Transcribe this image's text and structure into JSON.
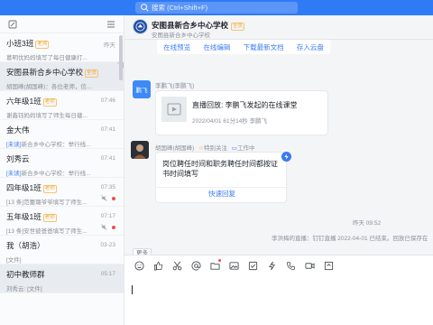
{
  "search": {
    "placeholder": "搜索 (Ctrl+Shift+F)"
  },
  "conversations": [
    {
      "name": "小班3班",
      "tag": "老师",
      "time": "昨天",
      "preview": "葛明优妈妈填写了每日健康打...",
      "preview_link": "",
      "active": false
    },
    {
      "name": "安图县新合乡中心学校",
      "tag": "全员",
      "time": "",
      "preview": "胡国峰(胡国峰)：各位老师，信...",
      "preview_link": "",
      "active": true
    },
    {
      "name": "六年级1班",
      "tag": "老师",
      "time": "07:46",
      "preview": "谢鑫钰妈妈填写了师生每日健...",
      "preview_link": "",
      "active": false
    },
    {
      "name": "金大伟",
      "tag": "",
      "time": "07:41",
      "preview": "新合乡中心学校：举行线...",
      "preview_link": "[未读]",
      "active": false
    },
    {
      "name": "刘秀云",
      "tag": "",
      "time": "07:41",
      "preview": "新合乡中心学校：举行线...",
      "preview_link": "[未读]",
      "active": false
    },
    {
      "name": "四年级1班",
      "tag": "老师",
      "time": "07:35",
      "preview": "[13 条]范蕾璐爷爷填写了师生...",
      "preview_link": "",
      "active": false
    },
    {
      "name": "五年级1班",
      "tag": "老师",
      "time": "07:17",
      "preview": "[13 条]安世彼爸爸填写了师生...",
      "preview_link": "",
      "active": false
    },
    {
      "name": "我（胡浩）",
      "tag": "",
      "time": "03-23",
      "preview": "[文件]",
      "preview_link": "",
      "active": false
    },
    {
      "name": "初中教师群",
      "tag": "",
      "time": "05:17",
      "preview": "刘秀云: [文件]",
      "preview_link": "",
      "active": false
    }
  ],
  "chat": {
    "title": "安图县新合乡中心学校",
    "tag": "全员",
    "subtitle": "安图县新合乡中心学校",
    "file_actions": [
      "在线预览",
      "在线编辑",
      "下载最新文档",
      "存入云盘"
    ],
    "msg1": {
      "avatar_label": "鹏飞",
      "sender": "李鹏飞(李鹏飞)",
      "live_title": "直播回放: 李鹏飞发起的在线课堂",
      "live_meta": "2022/04/01   61分14秒   李鹏飞"
    },
    "msg2": {
      "sender": "胡国峰(胡国峰)",
      "special": "特别关注",
      "org": "工作中",
      "text": "岗位聘任时间和职务聘任时间都按证书时间填写",
      "reply": "快速回复"
    },
    "time_sep": "昨天 09:52",
    "notice": "李洪梅的直播：钉钉直播 2022-04-01 已结束。回放已保存在",
    "more": "更多"
  },
  "icons": [
    "emoji-icon",
    "thumbs-up-icon",
    "scissors-icon",
    "at-icon",
    "folder-icon",
    "image-icon",
    "check-square-icon",
    "lightning-icon",
    "phone-icon",
    "video-icon",
    "expand-icon"
  ],
  "colors": {
    "accent": "#2f7bf6",
    "link": "#3a7bf0",
    "badge": "#f5a623",
    "unread": "#f54a45"
  }
}
